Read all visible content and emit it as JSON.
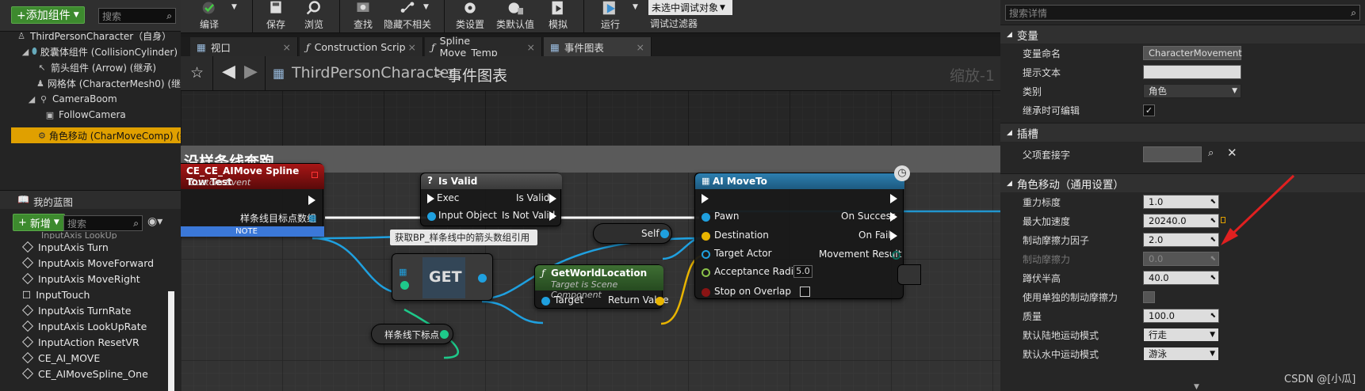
{
  "components": {
    "add_label": "+添加组件",
    "search_placeholder": "搜索",
    "root": "ThirdPersonCharacter（自身）",
    "items": [
      "胶囊体组件 (CollisionCylinder) (",
      "箭头组件 (Arrow) (继承)",
      "网格体 (CharacterMesh0) (继承",
      "CameraBoom",
      "FollowCamera",
      "角色移动 (CharMoveComp) (继承"
    ]
  },
  "blueprint": {
    "title": "我的蓝图",
    "new_label": "新增",
    "search_placeholder": "搜索",
    "truncated_item": "InputAxis LookUp",
    "items": [
      "InputAxis Turn",
      "InputAxis MoveForward",
      "InputAxis MoveRight",
      "InputTouch",
      "InputAxis TurnRate",
      "InputAxis LookUpRate",
      "InputAction ResetVR",
      "CE_AI_MOVE",
      "CE_AIMoveSpline_One"
    ]
  },
  "toolbar": {
    "compile": "编译",
    "save": "保存",
    "browse": "浏览",
    "find": "查找",
    "hide_unrelated": "隐藏不相关",
    "class_settings": "类设置",
    "class_defaults": "类默认值",
    "simulate": "模拟",
    "run": "运行",
    "debug_object": "未选中调试对象",
    "debug_filter": "调试过滤器"
  },
  "tabs": [
    "视口",
    "Construction Scrip",
    "Spline Move_Temp",
    "事件图表"
  ],
  "graph": {
    "breadcrumb_root": "ThirdPersonCharacter",
    "breadcrumb_sep": ">",
    "breadcrumb_leaf": "事件图表",
    "zoom": "缩放-1",
    "comment_title": "沿样条线奔跑",
    "event_node": {
      "title": "CE_CE_AIMove Spline Tow Test",
      "subtitle": "Custom Event",
      "pin": "样条线目标点数组",
      "note": "NOTE"
    },
    "isvalid_node": {
      "title": "Is Valid",
      "exec": "Exec",
      "is_valid": "Is Valid",
      "input_object": "Input Object",
      "is_not_valid": "Is Not Valid"
    },
    "comment_bubble": "获取BP_样条线中的箭头数组引用",
    "get_node": "GET",
    "self_node": "Self",
    "getworld_node": {
      "title": "GetWorldLocation",
      "subtitle": "Target is Scene Component",
      "target": "Target",
      "return": "Return Value"
    },
    "spline_idx_node": "样条线下标点",
    "aimove_node": {
      "title": "AI MoveTo",
      "pawn": "Pawn",
      "destination": "Destination",
      "target_actor": "Target Actor",
      "acceptance": "Acceptance Radius",
      "acceptance_val": "5.0",
      "stop_overlap": "Stop on Overlap",
      "on_success": "On Success",
      "on_fail": "On Fail",
      "movement_result": "Movement Result"
    }
  },
  "details": {
    "search_placeholder": "搜索详情",
    "sections": {
      "variable": "变量",
      "socket": "插槽",
      "movement": "角色移动（通用设置）"
    },
    "variable_rows": [
      {
        "label": "变量命名",
        "value": "CharacterMovement"
      },
      {
        "label": "提示文本",
        "value": ""
      },
      {
        "label": "类别",
        "value": "角色"
      },
      {
        "label": "继承时可编辑",
        "value": "✓"
      }
    ],
    "socket_rows": [
      {
        "label": "父项套接字",
        "value": ""
      }
    ],
    "movement_rows": [
      {
        "label": "重力标度",
        "value": "1.0"
      },
      {
        "label": "最大加速度",
        "value": "20240.0"
      },
      {
        "label": "制动摩擦力因子",
        "value": "2.0"
      },
      {
        "label": "制动摩擦力",
        "value": "0.0"
      },
      {
        "label": "蹲伏半高",
        "value": "40.0"
      },
      {
        "label": "使用单独的制动摩擦力",
        "value": ""
      },
      {
        "label": "质量",
        "value": "100.0"
      },
      {
        "label": "默认陆地运动模式",
        "value": "行走"
      },
      {
        "label": "默认水中运动模式",
        "value": "游泳"
      }
    ]
  },
  "watermark": "CSDN @[小瓜]",
  "colors": {
    "accent_green": "#3d8a2e",
    "selection": "#e0a000",
    "event_red": "#8a1010",
    "annotation_red": "#e02020"
  }
}
